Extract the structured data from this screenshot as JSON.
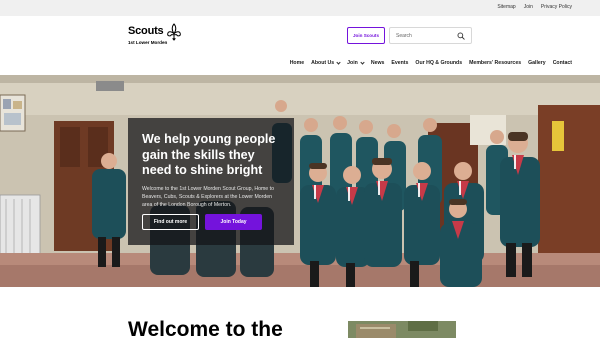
{
  "utility_nav": [
    "Sitemap",
    "Join",
    "Privacy Policy"
  ],
  "logo": {
    "word": "Scouts",
    "group": "1st Lower Morden"
  },
  "header": {
    "join_button": "Join Scouts",
    "search_placeholder": "Search"
  },
  "nav": {
    "items": [
      {
        "label": "Home",
        "dropdown": false
      },
      {
        "label": "About Us",
        "dropdown": true
      },
      {
        "label": "Join",
        "dropdown": true
      },
      {
        "label": "News",
        "dropdown": false
      },
      {
        "label": "Events",
        "dropdown": false
      },
      {
        "label": "Our HQ & Grounds",
        "dropdown": false
      },
      {
        "label": "Members' Resources",
        "dropdown": false
      },
      {
        "label": "Gallery",
        "dropdown": false
      },
      {
        "label": "Contact",
        "dropdown": false
      }
    ]
  },
  "hero": {
    "title": "We help young people gain the skills they need to shine bright",
    "text": "Welcome to the 1st Lower Morden Scout Group, Home to Beavers, Cubs, Scouts & Explorers at the Lower Morden area of the London Borough of Merton.",
    "button_secondary": "Find out more",
    "button_primary": "Join Today"
  },
  "welcome_heading": "Welcome to the",
  "colors": {
    "brand_purple": "#7413dc",
    "uniform_teal": "#1f5660",
    "card_overlay": "#141418"
  },
  "icons": {
    "logo": "fleur-de-lis-icon",
    "search": "search-icon",
    "dropdown": "chevron-down-icon"
  }
}
